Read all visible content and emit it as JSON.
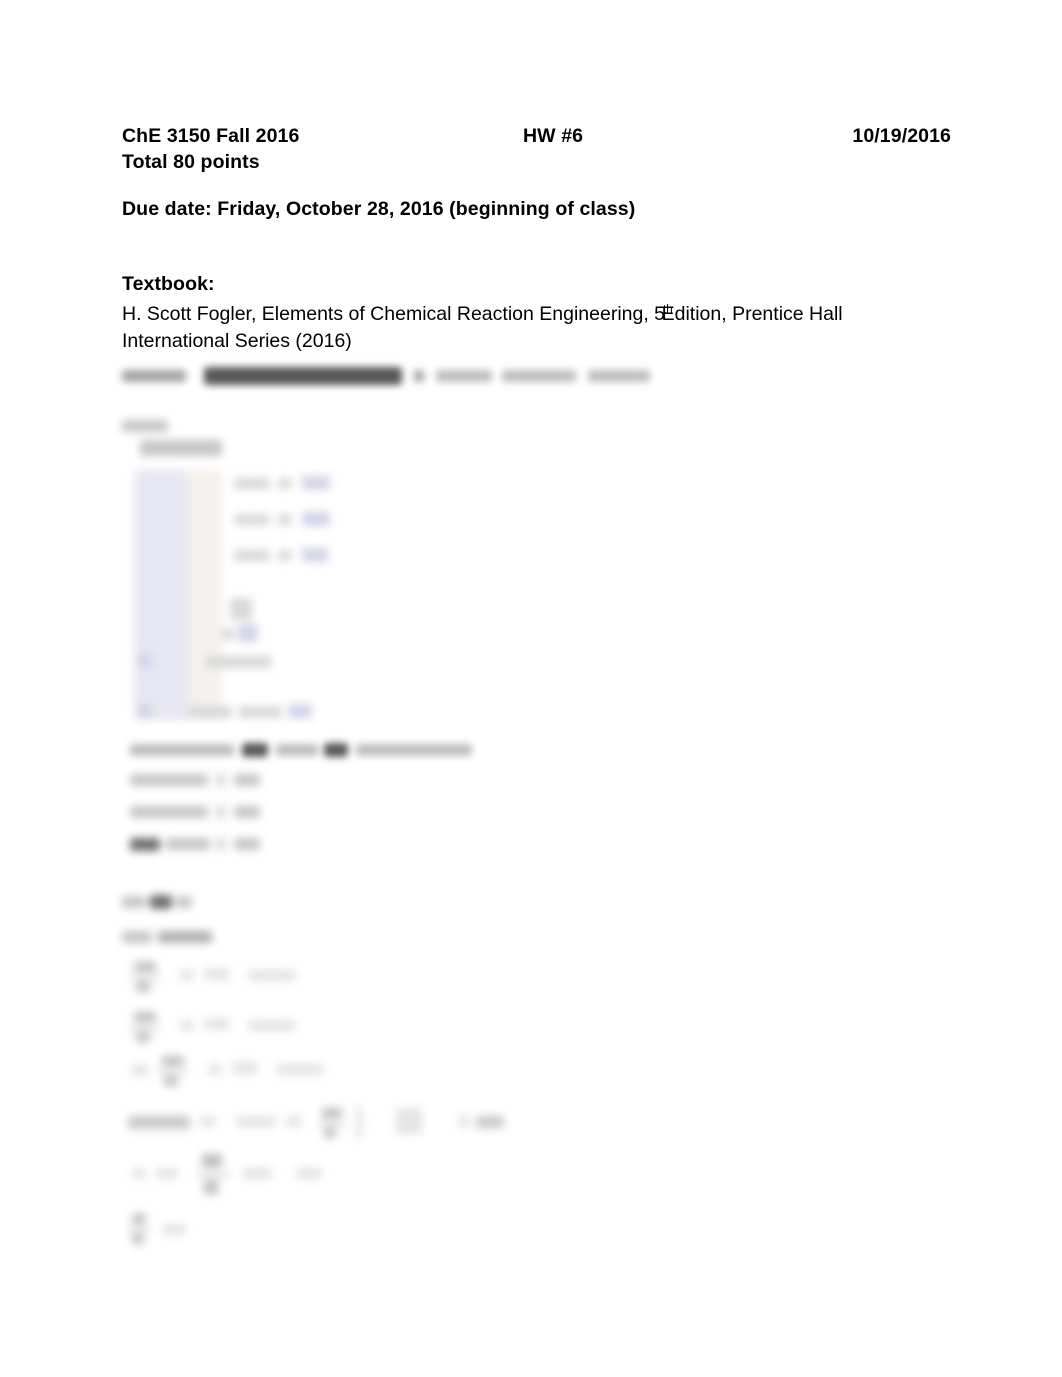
{
  "document": {
    "kind": "homework-assignment-handout",
    "page_background": "#ffffff",
    "text_color": "#000000"
  },
  "header": {
    "course": "ChE 3150 Fall 2016",
    "assignment": "HW #6",
    "date": "10/19/2016",
    "points": "Total 80 points"
  },
  "due": {
    "line": "Due date: Friday, October 28, 2016 (beginning of class)"
  },
  "textbook": {
    "label": "Textbook:",
    "reference_line1_a": "H. Scott Fogler, Elements of Chemical Reaction Engineering, 5",
    "reference_ordinal": "th",
    "reference_line1_b": "Edition, Prentice Hall",
    "reference_line2": "International Series (2016)"
  },
  "obscured": {
    "note": "blurred-content",
    "regions": [
      {
        "id": "problem-1-statement",
        "kind": "paragraph-with-bold-underline"
      },
      {
        "id": "solution-label",
        "kind": "short-label"
      },
      {
        "id": "data-table-block",
        "kind": "tinted-table",
        "tint": "#e2e2ee"
      },
      {
        "id": "table-equations",
        "kind": "equation-rows"
      },
      {
        "id": "answer-lines",
        "kind": "short-answer-lines"
      },
      {
        "id": "problem-2-statement",
        "kind": "short-label"
      },
      {
        "id": "derivation-block",
        "kind": "equation-stack"
      }
    ]
  }
}
